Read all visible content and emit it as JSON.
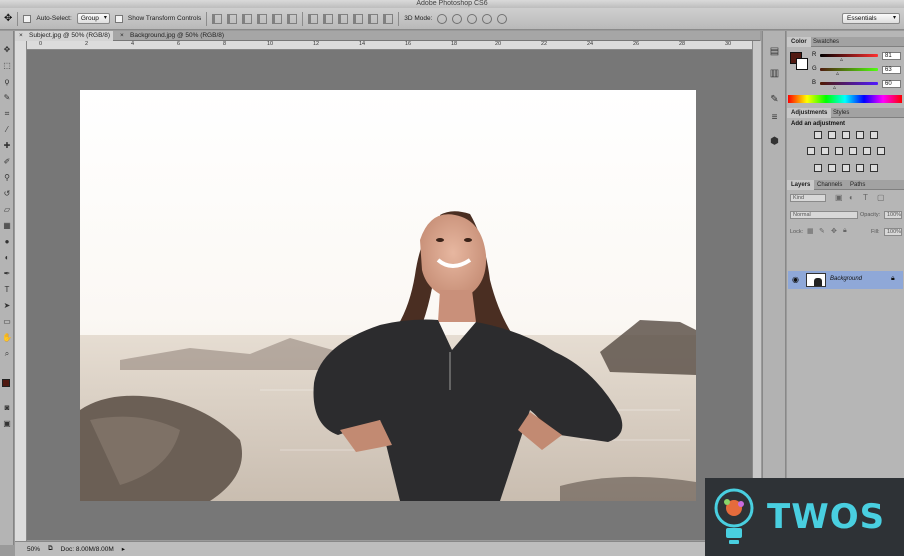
{
  "app": {
    "title": "Adobe Photoshop CS6"
  },
  "options": {
    "auto_select_label": "Auto-Select:",
    "auto_select_value": "Group",
    "show_transform_label": "Show Transform Controls",
    "mode_3d_label": "3D Mode:",
    "workspace_value": "Essentials"
  },
  "tabs": [
    {
      "label": "Subject.jpg @ 50% (RGB/8)"
    },
    {
      "label": "Background.jpg @ 50% (RGB/8)"
    }
  ],
  "ruler": {
    "h_ticks": [
      "0",
      "2",
      "4",
      "6",
      "8",
      "10",
      "12",
      "14",
      "16",
      "18",
      "20",
      "22",
      "24",
      "26",
      "28",
      "30"
    ]
  },
  "status": {
    "zoom": "50%",
    "doc": "Doc: 8.00M/8.00M"
  },
  "color_panel": {
    "tabs": [
      "Color",
      "Swatches"
    ],
    "channels": [
      {
        "name": "R",
        "value": "81"
      },
      {
        "name": "G",
        "value": "63"
      },
      {
        "name": "B",
        "value": "60"
      }
    ],
    "foreground_color": "#511a12"
  },
  "adjustments_panel": {
    "tabs": [
      "Adjustments",
      "Styles"
    ],
    "heading": "Add an adjustment"
  },
  "layers_panel": {
    "tabs": [
      "Layers",
      "Channels",
      "Paths"
    ],
    "kind_value": "Kind",
    "blend_mode": "Normal",
    "opacity_label": "Opacity:",
    "opacity_value": "100%",
    "lock_label": "Lock:",
    "fill_label": "Fill:",
    "fill_value": "100%",
    "layers": [
      {
        "name": "Background",
        "locked": true
      }
    ]
  },
  "watermark": {
    "text": "TWOS"
  }
}
